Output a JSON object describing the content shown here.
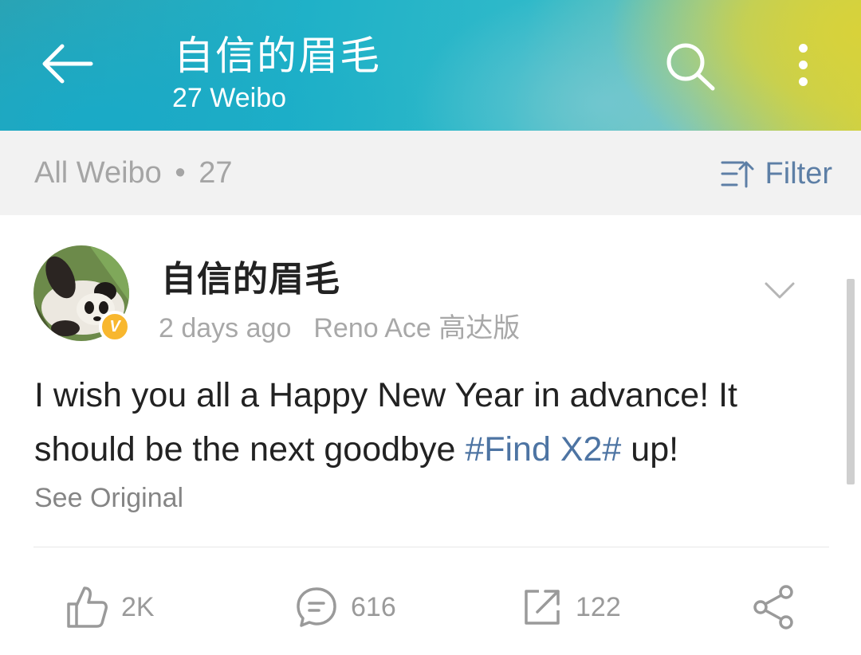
{
  "header": {
    "title": "自信的眉毛",
    "subtitle": "27 Weibo",
    "colors": {
      "gradient_left": "#1fb1c8",
      "gradient_right": "#d8d23a"
    }
  },
  "filter_bar": {
    "label": "All Weibo",
    "separator": "•",
    "count": "27",
    "filter_label": "Filter"
  },
  "post": {
    "username": "自信的眉毛",
    "verified_badge": "V",
    "time": "2 days ago",
    "device": "Reno Ace 高达版",
    "text_before": "I wish you all a Happy New Year in advance! It should be the next goodbye ",
    "hashtag": "#Find X2#",
    "text_after": " up!",
    "see_original": "See Original",
    "colors": {
      "hashtag": "#4d74a3",
      "verified": "#f8b72e"
    }
  },
  "actions": {
    "likes": "2K",
    "comments": "616",
    "reposts": "122"
  },
  "icons": [
    "back-arrow-icon",
    "search-icon",
    "more-vertical-icon",
    "filter-icon",
    "chevron-down-icon",
    "like-icon",
    "comment-icon",
    "repost-icon",
    "share-icon"
  ]
}
